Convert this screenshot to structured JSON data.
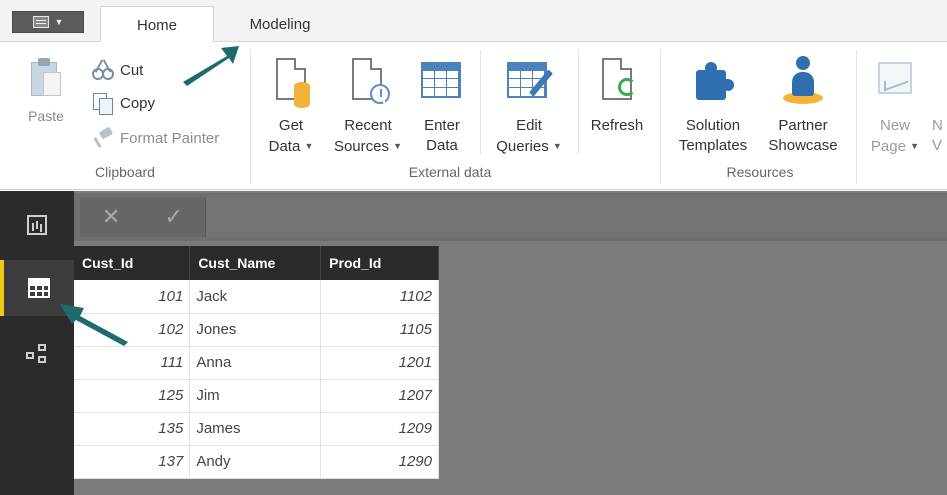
{
  "tabs": {
    "file_menu": "file-menu",
    "home": "Home",
    "modeling": "Modeling"
  },
  "ribbon": {
    "clipboard": {
      "label": "Clipboard",
      "paste": "Paste",
      "cut": "Cut",
      "copy": "Copy",
      "format_painter": "Format Painter"
    },
    "external_data": {
      "label": "External data",
      "get_data": [
        "Get",
        "Data"
      ],
      "recent_sources": [
        "Recent",
        "Sources"
      ],
      "enter_data": [
        "Enter",
        "Data"
      ],
      "edit_queries": [
        "Edit",
        "Queries"
      ],
      "refresh": "Refresh"
    },
    "resources": {
      "label": "Resources",
      "solution_templates": [
        "Solution",
        "Templates"
      ],
      "partner_showcase": [
        "Partner",
        "Showcase"
      ]
    },
    "new_page": [
      "New",
      "Page"
    ],
    "clipped_next": [
      "N",
      "V"
    ]
  },
  "nav": {
    "items": [
      {
        "name": "report-view",
        "icon": "report-icon"
      },
      {
        "name": "data-view",
        "icon": "data-grid-icon",
        "active": true
      },
      {
        "name": "relationships-view",
        "icon": "relationships-icon"
      }
    ],
    "active_color": "#f2c811"
  },
  "formula_bar": {
    "cancel": "✕",
    "commit": "✓"
  },
  "table": {
    "columns": [
      "Cust_Id",
      "Cust_Name",
      "Prod_Id"
    ],
    "rows": [
      [
        "101",
        "Jack",
        "1102"
      ],
      [
        "102",
        "Jones",
        "1105"
      ],
      [
        "111",
        "Anna",
        "1201"
      ],
      [
        "125",
        "Jim",
        "1207"
      ],
      [
        "135",
        "James",
        "1209"
      ],
      [
        "137",
        "Andy",
        "1290"
      ]
    ]
  },
  "annotation_color": "#1f6b6b"
}
